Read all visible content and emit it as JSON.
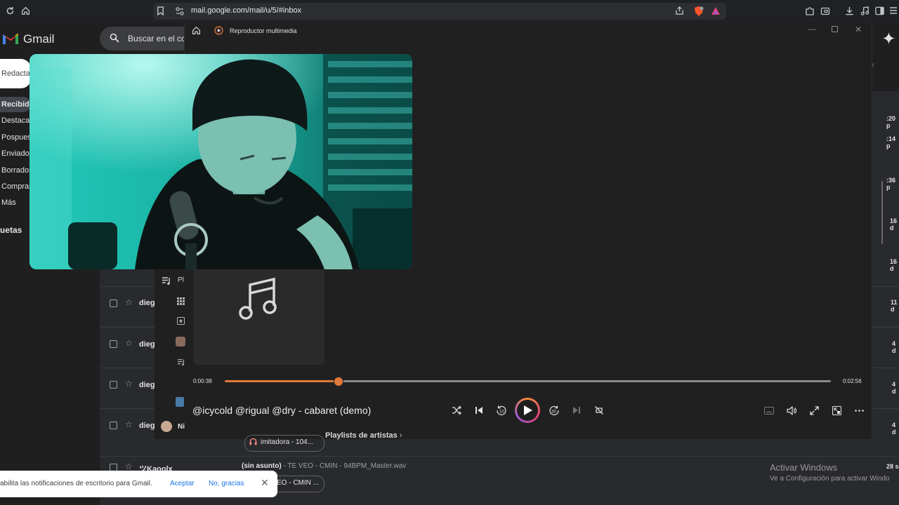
{
  "browser": {
    "url": "mail.google.com/mail/u/5/#inbox"
  },
  "gmail": {
    "logo_text": "Gmail",
    "search_placeholder": "Buscar en el co",
    "compose_label": "Redacta",
    "nav": [
      "Recibido",
      "Destacad",
      "Pospues",
      "Enviados",
      "Borrador",
      "Compras",
      "Más"
    ],
    "labels_heading": "uetas",
    "rows": [
      {
        "sender": "dieg",
        "date": "11 d"
      },
      {
        "sender": "dieg",
        "date": "4 d"
      },
      {
        "sender": "dieg",
        "date": "4 d"
      },
      {
        "sender": "dieg",
        "sender2": "Ni",
        "date": "4 d"
      },
      {
        "sender": "ツKaoolx",
        "date": "28 s"
      }
    ],
    "side_dates": [
      ":20 p",
      ":14 p",
      ":36 p",
      "16 d",
      "16 d"
    ],
    "chip_1": "imitadora - 104...",
    "chip_2": "EO - CMIN ...",
    "row_subject": "(sin asunto)",
    "row_snippet": " - TE VEO - CMIN - 94BPM_Master.wav",
    "playlists_label": "Playlists de artistas",
    "playlists_chevron": "›",
    "mini_label": "Pl"
  },
  "player": {
    "window_title": "Reproductor multimedia",
    "time_current": "0:00:38",
    "time_total": "0:02:56",
    "progress_fraction": 0.186,
    "song_title": "@icycold @rigual @dry - cabaret (demo)",
    "accent_color": "#e07a3a"
  },
  "notification": {
    "text": "abilita las notificaciones de escritorio para Gmail.",
    "accept_label": "Aceptar",
    "decline_label": "No, gracias",
    "close_glyph": "✕"
  },
  "windows_watermark": {
    "line1": "Activar Windows",
    "line2": "Ve a Configuración para activar Windo"
  }
}
